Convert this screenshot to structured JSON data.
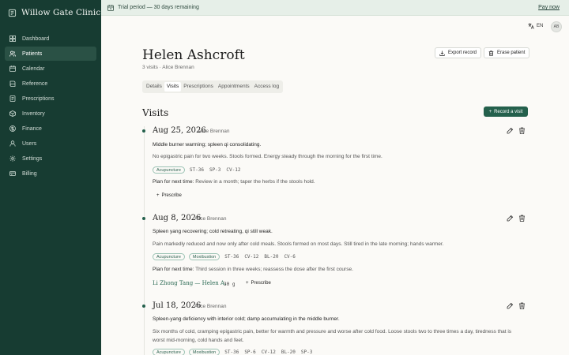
{
  "brand": {
    "name": "Willow Gate Clinic"
  },
  "sidebar": {
    "items": [
      {
        "label": "Dashboard",
        "icon": "dashboard-icon"
      },
      {
        "label": "Patients",
        "icon": "users-icon",
        "active": true
      },
      {
        "label": "Calendar",
        "icon": "calendar-icon"
      },
      {
        "label": "Reference",
        "icon": "book-icon"
      },
      {
        "label": "Prescriptions",
        "icon": "prescription-icon"
      },
      {
        "label": "Inventory",
        "icon": "box-icon"
      },
      {
        "label": "Finance",
        "icon": "finance-icon"
      },
      {
        "label": "Users",
        "icon": "user-icon"
      },
      {
        "label": "Settings",
        "icon": "gear-icon"
      },
      {
        "label": "Billing",
        "icon": "billing-icon"
      }
    ]
  },
  "banner": {
    "text": "Trial period — 30 days remaining",
    "action": "Pay now"
  },
  "topbar": {
    "lang": "EN",
    "avatar": "AB"
  },
  "patient": {
    "name": "Helen Ashcroft",
    "subtitle": "3 visits · Alice Brennan",
    "export_label": "Export record",
    "erase_label": "Erase patient"
  },
  "tabs": [
    {
      "label": "Details"
    },
    {
      "label": "Visits",
      "active": true
    },
    {
      "label": "Prescriptions"
    },
    {
      "label": "Appointments"
    },
    {
      "label": "Access log"
    }
  ],
  "visits_section": {
    "title": "Visits",
    "record_label": "Record a visit"
  },
  "visits": [
    {
      "date": "Aug 25, 2026",
      "practitioner": "Alice Brennan",
      "title": "Middle burner warming; spleen qi consolidating.",
      "note": "No epigastric pain for two weeks. Stools formed. Energy steady through the morning for the first time.",
      "tags": [
        "Acupuncture"
      ],
      "points": [
        "ST-36",
        "SP-3",
        "CV-12"
      ],
      "plan_label": "Plan for next time:",
      "plan": "Review in a month; taper the herbs if the stools hold.",
      "prescribe_label": "Prescribe"
    },
    {
      "date": "Aug 8, 2026",
      "practitioner": "Alice Brennan",
      "title": "Spleen yang recovering; cold retreating, qi still weak.",
      "note": "Pain markedly reduced and now only after cold meals. Stools formed on most days. Still tired in the late morning; hands warmer.",
      "tags": [
        "Acupuncture",
        "Moxibustion"
      ],
      "points": [
        "ST-36",
        "CV-12",
        "BL-20",
        "CV-6"
      ],
      "plan_label": "Plan for next time:",
      "plan": "Third session in three weeks; reassess the dose after the first course.",
      "rx_name": "Li Zhong Tang — Helen A.",
      "rx_dose": "30 g",
      "prescribe_label": "Prescribe"
    },
    {
      "date": "Jul 18, 2026",
      "practitioner": "Alice Brennan",
      "title": "Spleen-yang deficiency with interior cold; damp accumulating in the middle burner.",
      "note_line1": "Six months of cold, cramping epigastric pain, better for warmth and pressure and worse after cold food. Loose stools two to three times a day, tiredness that is",
      "note_line2": "worst mid-morning, cold hands and feet.",
      "tags": [
        "Acupuncture",
        "Moxibustion"
      ],
      "points": [
        "ST-36",
        "SP-6",
        "CV-12",
        "BL-20",
        "SP-3"
      ]
    }
  ]
}
